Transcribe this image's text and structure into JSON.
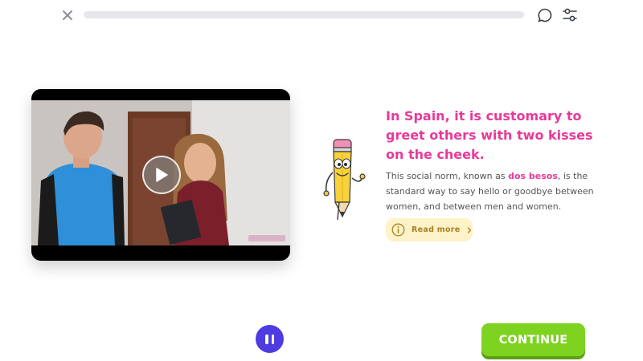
{
  "header": {
    "progress": 0
  },
  "lesson": {
    "headline": "In Spain, it is customary to greet others with two kisses on the cheek.",
    "body_before": "This social norm, known as ",
    "body_highlight": "dos besos",
    "body_after": ", is the standard way to say hello or goodbye between women, and between men and women.",
    "read_more_label": "Read more"
  },
  "footer": {
    "continue_label": "CONTINUE"
  },
  "colors": {
    "accent": "#e8399a",
    "continue": "#7ed321",
    "pause": "#4e3ce0",
    "read_more_bg": "#fdf2c8"
  }
}
